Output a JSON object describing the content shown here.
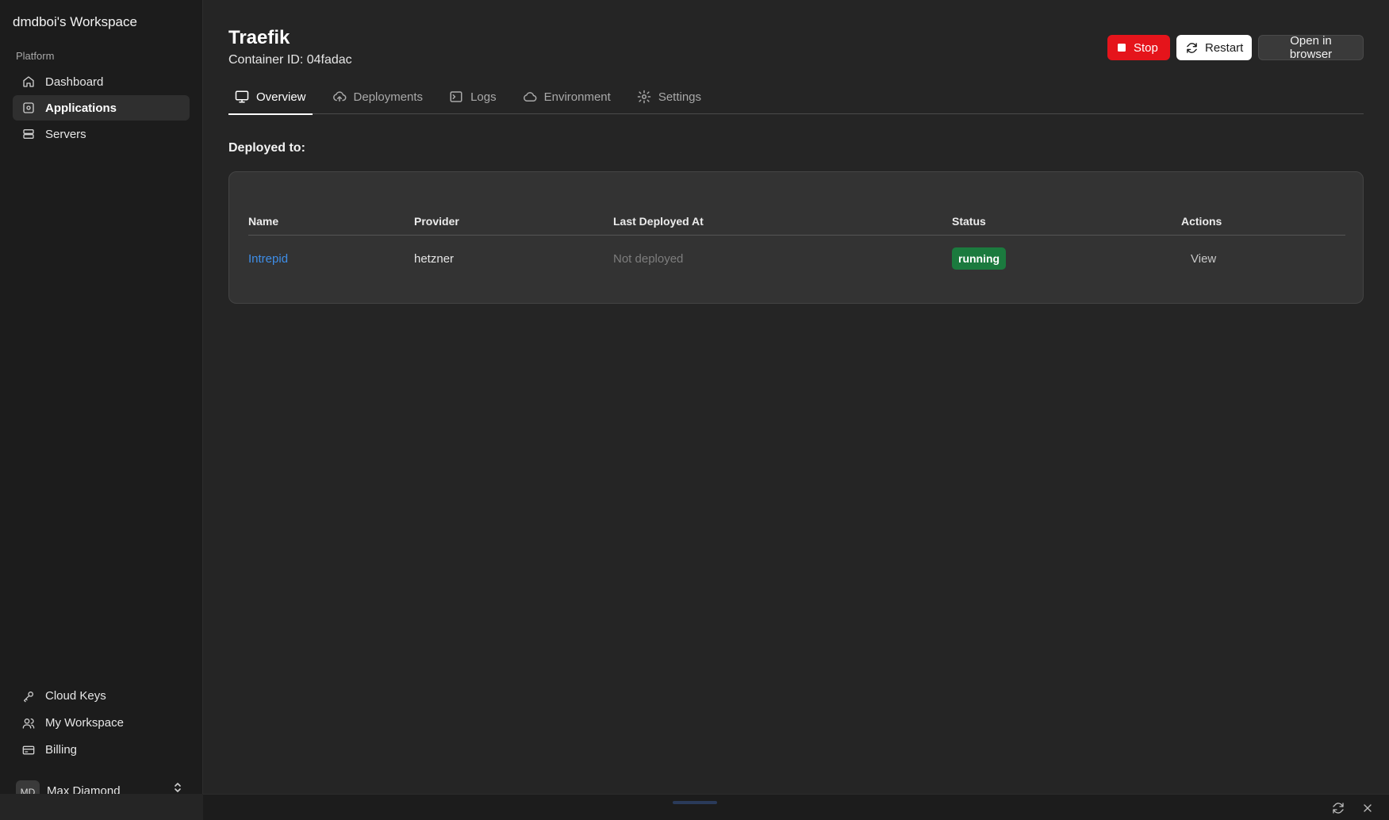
{
  "sidebar": {
    "workspace_title": "dmdboi's Workspace",
    "section_label": "Platform",
    "nav_top": [
      {
        "label": "Dashboard",
        "icon": "home-icon"
      },
      {
        "label": "Applications",
        "icon": "app-icon",
        "active": true
      },
      {
        "label": "Servers",
        "icon": "server-icon"
      }
    ],
    "nav_bottom": [
      {
        "label": "Cloud Keys",
        "icon": "key-icon"
      },
      {
        "label": "My Workspace",
        "icon": "users-icon"
      },
      {
        "label": "Billing",
        "icon": "credit-card-icon"
      }
    ],
    "user": {
      "initials": "MD",
      "name": "Max Diamond"
    }
  },
  "header": {
    "title": "Traefik",
    "container_id": "Container ID: 04fadac",
    "actions": {
      "stop": "Stop",
      "restart": "Restart",
      "open": "Open in browser"
    }
  },
  "tabs": [
    {
      "label": "Overview",
      "icon": "monitor-icon",
      "active": true
    },
    {
      "label": "Deployments",
      "icon": "cloud-upload-icon"
    },
    {
      "label": "Logs",
      "icon": "terminal-icon"
    },
    {
      "label": "Environment",
      "icon": "cloud-icon"
    },
    {
      "label": "Settings",
      "icon": "gear-icon"
    }
  ],
  "deployed": {
    "title": "Deployed to:",
    "columns": [
      "Name",
      "Provider",
      "Last Deployed At",
      "Status",
      "Actions"
    ],
    "rows": [
      {
        "name": "Intrepid",
        "provider": "hetzner",
        "last_deployed": "Not deployed",
        "status": "running",
        "action": "View"
      }
    ]
  },
  "colors": {
    "stop": "#e5141b",
    "status_running": "#1b7a3e",
    "link": "#3e8ee8"
  }
}
